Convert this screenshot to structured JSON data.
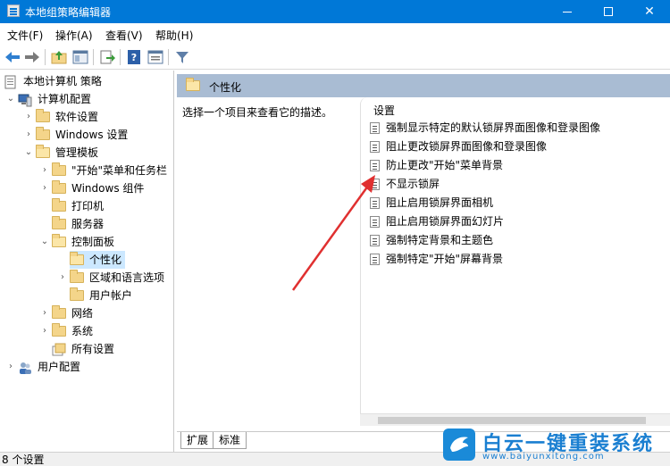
{
  "window": {
    "title": "本地组策略编辑器"
  },
  "menu": [
    "文件(F)",
    "操作(A)",
    "查看(V)",
    "帮助(H)"
  ],
  "toolbar_icons": [
    "back-arrow-icon",
    "forward-arrow-icon",
    "folder-up-icon",
    "show-hide-tree-icon",
    "export-icon",
    "help-icon",
    "properties-icon",
    "filter-icon"
  ],
  "tree": {
    "root": "本地计算机 策略",
    "computer_config": "计算机配置",
    "software_settings": "软件设置",
    "windows_settings": "Windows 设置",
    "admin_templates": "管理模板",
    "start_menu": "\"开始\"菜单和任务栏",
    "windows_components": "Windows 组件",
    "printers": "打印机",
    "server": "服务器",
    "control_panel": "控制面板",
    "personalization": "个性化",
    "region_language": "区域和语言选项",
    "user_accounts": "用户帐户",
    "network": "网络",
    "system": "系统",
    "all_settings": "所有设置",
    "user_config": "用户配置"
  },
  "right_pane": {
    "header": "个性化",
    "description": "选择一个项目来查看它的描述。",
    "settings_header": "设置",
    "settings": [
      "强制显示特定的默认锁屏界面图像和登录图像",
      "阻止更改锁屏界面图像和登录图像",
      "防止更改\"开始\"菜单背景",
      "不显示锁屏",
      "阻止启用锁屏界面相机",
      "阻止启用锁屏界面幻灯片",
      "强制特定背景和主题色",
      "强制特定\"开始\"屏幕背景"
    ]
  },
  "tabs": [
    "扩展",
    "标准"
  ],
  "status": "8 个设置",
  "watermark": {
    "title": "白云一键重装系统",
    "url": "www.baiyunxitong.com"
  },
  "colors": {
    "titlebar": "#0078d7",
    "selection": "#cce8ff",
    "header_bar": "#a9bcd3",
    "annotation_arrow": "#e03030"
  }
}
